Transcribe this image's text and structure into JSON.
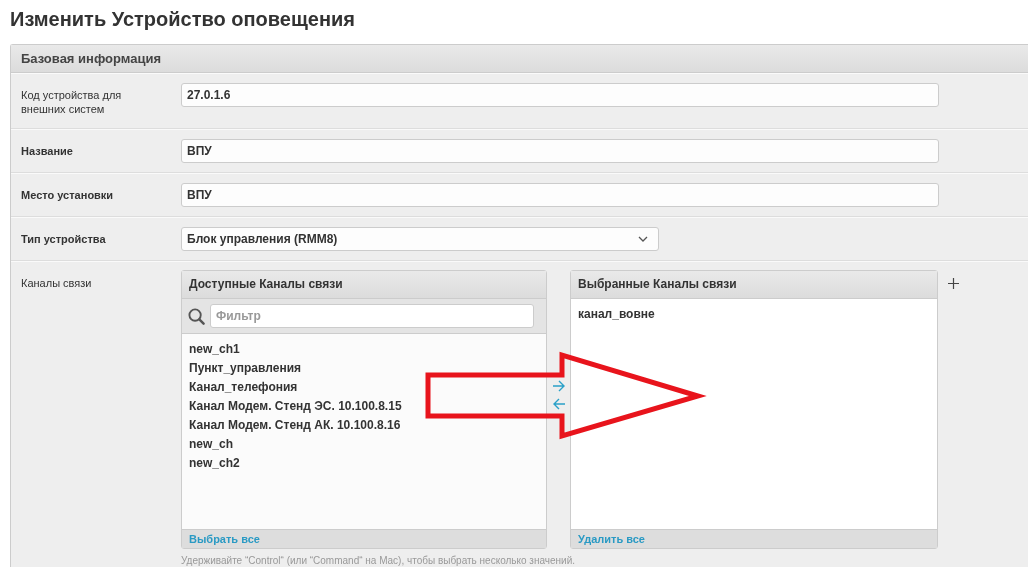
{
  "title": "Изменить Устройство оповещения",
  "section": {
    "title": "Базовая информация"
  },
  "fields": [
    {
      "kind": "text",
      "label": "Код устройства для внешних систем",
      "required": false,
      "value": "27.0.1.6"
    },
    {
      "kind": "text",
      "label": "Название",
      "required": true,
      "value": "ВПУ"
    },
    {
      "kind": "text",
      "label": "Место установки",
      "required": true,
      "value": "ВПУ"
    },
    {
      "kind": "select",
      "label": "Тип устройства",
      "required": true,
      "value": "Блок управления (RMM8)"
    }
  ],
  "channels": {
    "label": "Каналы связи",
    "required": false,
    "available": {
      "title": "Доступные Каналы связи",
      "filter_placeholder": "Фильтр",
      "items": [
        "new_ch1",
        "Пункт_управления",
        "Канал_телефония",
        "Канал Модем. Стенд ЭС. 10.100.8.15",
        "Канал Модем. Стенд АК. 10.100.8.16",
        "new_ch",
        "new_ch2"
      ],
      "footer_link": "Выбрать все"
    },
    "chosen": {
      "title": "Выбранные Каналы связи",
      "items": [
        "канал_вовне"
      ],
      "footer_link": "Удалить все"
    },
    "help": "Удерживайте “Control“ (или “Command“ на Mac), чтобы выбрать несколько значений."
  }
}
